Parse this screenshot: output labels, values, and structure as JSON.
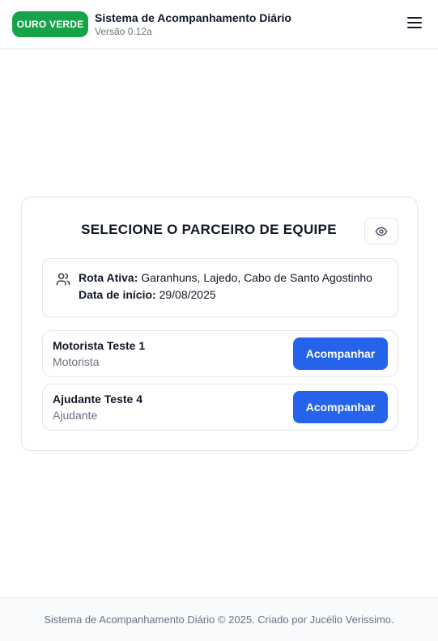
{
  "header": {
    "brand": "OURO VERDE",
    "title": "Sistema de Acompanhamento Diário",
    "version": "Versão 0.12a",
    "menu_icon": "hamburger-menu-icon"
  },
  "card": {
    "title": "SELECIONE O PARCEIRO DE EQUIPE",
    "visibility_icon": "eye-icon",
    "route": {
      "icon": "users-icon",
      "route_label": "Rota Ativa:",
      "route_value": "Garanhuns, Lajedo, Cabo de Santo Agostinho",
      "start_label": "Data de início:",
      "start_value": "29/08/2025"
    },
    "partners": [
      {
        "name": "Motorista Teste 1",
        "role": "Motorista",
        "action": "Acompanhar"
      },
      {
        "name": "Ajudante Teste 4",
        "role": "Ajudante",
        "action": "Acompanhar"
      }
    ]
  },
  "footer": {
    "text": "Sistema de Acompanhamento Diário © 2025. Criado por Jucélio Verissimo."
  },
  "colors": {
    "brand_green": "#16a34a",
    "primary_blue": "#2563eb",
    "muted_text": "#6b7280",
    "border": "#e5e7eb"
  }
}
